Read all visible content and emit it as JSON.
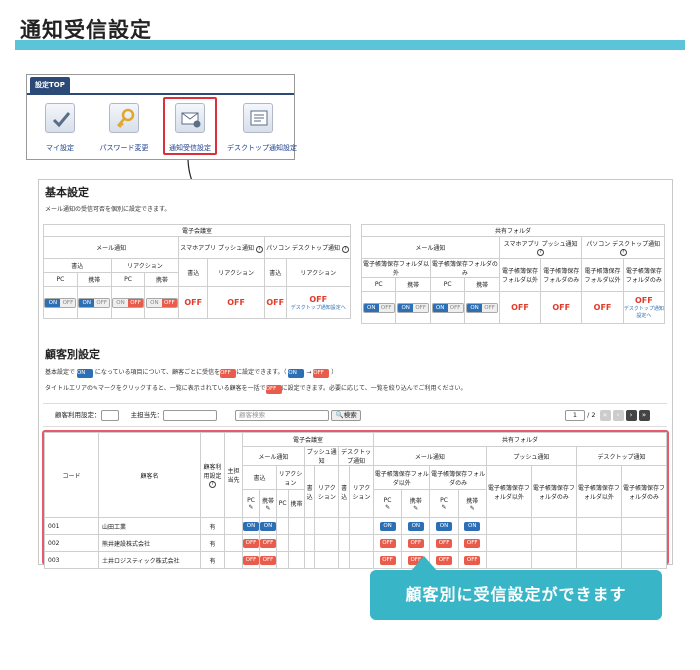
{
  "page_title": "通知受信設定",
  "panel": {
    "tab": "設定TOP",
    "items": [
      {
        "label": "マイ設定",
        "icon": "check-icon"
      },
      {
        "label": "パスワード変更",
        "icon": "key-icon"
      },
      {
        "label": "通知受信設定",
        "icon": "mail-gear-icon"
      },
      {
        "label": "デスクトップ通知設定",
        "icon": "message-icon"
      }
    ]
  },
  "basic": {
    "title": "基本設定",
    "desc": "メール通知の受信可否を個別に設定できます。",
    "left": {
      "group": "電子会議室",
      "mail": "メール通知",
      "smartphone": "スマホアプリ プッシュ通知",
      "pc": "パソコン デスクトップ通知",
      "write": "書込",
      "reaction": "リアクション",
      "pc_col": "PC",
      "mobile": "携帯",
      "on": "ON",
      "off": "OFF",
      "link": "デスクトップ通知設定へ"
    },
    "right": {
      "group": "共有フォルダ",
      "mail": "メール通知",
      "smartphone": "スマホアプリ プッシュ通知",
      "pc": "パソコン デスクトップ通知",
      "c1": "電子帳簿保存フォルダ以外",
      "c2": "電子帳簿保存フォルダのみ",
      "c3": "電子帳簿保存フォルダ以外",
      "c4": "電子帳簿保存フォルダのみ",
      "c5": "電子帳簿保存フォルダ以外",
      "c6": "電子帳簿保存フォルダのみ",
      "pc_col": "PC",
      "mobile": "携帯",
      "on": "ON",
      "off": "OFF",
      "link": "デスクトップ通知設定へ"
    }
  },
  "customer": {
    "title": "顧客別設定",
    "desc1a": "基本設定で",
    "desc1b": "になっている項目について、顧客ごとに受信を",
    "desc1c": "に設定できます。（",
    "desc1d": "）",
    "desc2a": "タイトルエリアの",
    "desc2b": "マークをクリックすると、一覧に表示されている顧客を一括で",
    "desc2c": "に設定できます。必要に応じて、一覧を絞り込んでご利用ください。",
    "filter_usage": "顧客利用設定：",
    "filter_owner": "主担当先：",
    "search_placeholder": "顧客検索",
    "search_btn": "検索",
    "page": "1",
    "pages": "/ 2",
    "cols": {
      "code": "コード",
      "name": "顧客名",
      "usage": "顧客利用設定",
      "owner": "主担当先",
      "conf": "電子会議室",
      "folder": "共有フォルダ",
      "mail": "メール通知",
      "push": "プッシュ通知",
      "desktop": "デスクトップ通知",
      "write": "書込",
      "reaction": "リアクション",
      "pc": "PC",
      "mobile": "携帯",
      "f1": "電子帳簿保存フォルダ以外",
      "f2": "電子帳簿保存フォルダのみ"
    },
    "rows": [
      {
        "code": "001",
        "name": "山田工業",
        "usage": "有",
        "state": "ON"
      },
      {
        "code": "002",
        "name": "熊井建設株式会社",
        "usage": "有",
        "state": "OFF"
      },
      {
        "code": "003",
        "name": "土井ロジスティック株式会社",
        "usage": "有",
        "state": "OFF"
      }
    ]
  },
  "banner": "顧客別に受信設定ができます"
}
